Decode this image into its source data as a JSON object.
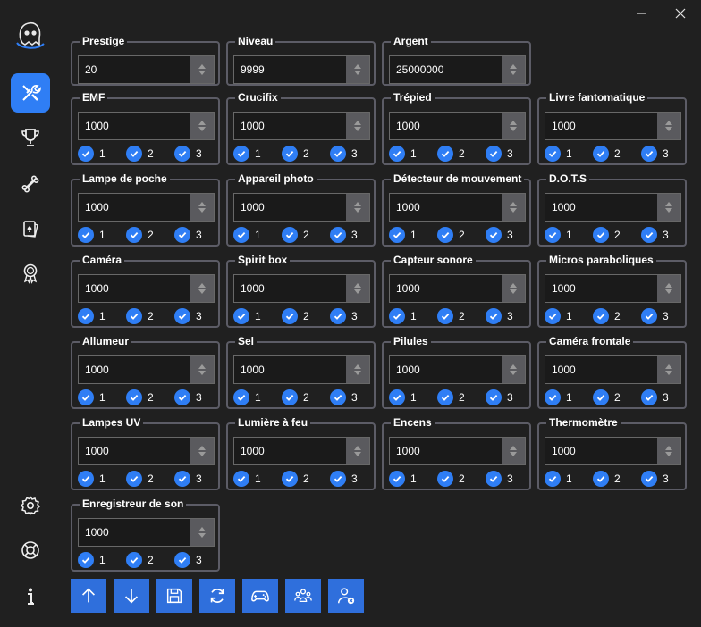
{
  "window": {
    "minimize_icon": "minimize-icon",
    "close_icon": "close-icon"
  },
  "sidebar": {
    "logo": "ghost-logo",
    "top_items": [
      {
        "icon": "tools-icon",
        "active": true
      },
      {
        "icon": "trophy-icon",
        "active": false
      },
      {
        "icon": "bone-icon",
        "active": false
      },
      {
        "icon": "cards-icon",
        "active": false
      },
      {
        "icon": "award-badge-icon",
        "active": false
      }
    ],
    "bottom_items": [
      {
        "icon": "gear-icon"
      },
      {
        "icon": "lifebuoy-icon"
      },
      {
        "icon": "info-icon"
      }
    ]
  },
  "stats": {
    "prestige": {
      "label": "Prestige",
      "value": "20"
    },
    "niveau": {
      "label": "Niveau",
      "value": "9999"
    },
    "argent": {
      "label": "Argent",
      "value": "25000000"
    }
  },
  "items": [
    {
      "label": "EMF",
      "value": "1000",
      "tiers": [
        "1",
        "2",
        "3"
      ]
    },
    {
      "label": "Crucifix",
      "value": "1000",
      "tiers": [
        "1",
        "2",
        "3"
      ]
    },
    {
      "label": "Trépied",
      "value": "1000",
      "tiers": [
        "1",
        "2",
        "3"
      ]
    },
    {
      "label": "Livre fantomatique",
      "value": "1000",
      "tiers": [
        "1",
        "2",
        "3"
      ]
    },
    {
      "label": "Lampe de poche",
      "value": "1000",
      "tiers": [
        "1",
        "2",
        "3"
      ]
    },
    {
      "label": "Appareil photo",
      "value": "1000",
      "tiers": [
        "1",
        "2",
        "3"
      ]
    },
    {
      "label": "Détecteur de mouvement",
      "value": "1000",
      "tiers": [
        "1",
        "2",
        "3"
      ]
    },
    {
      "label": "D.O.T.S",
      "value": "1000",
      "tiers": [
        "1",
        "2",
        "3"
      ]
    },
    {
      "label": "Caméra",
      "value": "1000",
      "tiers": [
        "1",
        "2",
        "3"
      ]
    },
    {
      "label": "Spirit box",
      "value": "1000",
      "tiers": [
        "1",
        "2",
        "3"
      ]
    },
    {
      "label": "Capteur sonore",
      "value": "1000",
      "tiers": [
        "1",
        "2",
        "3"
      ]
    },
    {
      "label": "Micros paraboliques",
      "value": "1000",
      "tiers": [
        "1",
        "2",
        "3"
      ]
    },
    {
      "label": "Allumeur",
      "value": "1000",
      "tiers": [
        "1",
        "2",
        "3"
      ]
    },
    {
      "label": "Sel",
      "value": "1000",
      "tiers": [
        "1",
        "2",
        "3"
      ]
    },
    {
      "label": "Pilules",
      "value": "1000",
      "tiers": [
        "1",
        "2",
        "3"
      ]
    },
    {
      "label": "Caméra frontale",
      "value": "1000",
      "tiers": [
        "1",
        "2",
        "3"
      ]
    },
    {
      "label": "Lampes UV",
      "value": "1000",
      "tiers": [
        "1",
        "2",
        "3"
      ]
    },
    {
      "label": "Lumière à feu",
      "value": "1000",
      "tiers": [
        "1",
        "2",
        "3"
      ]
    },
    {
      "label": "Encens",
      "value": "1000",
      "tiers": [
        "1",
        "2",
        "3"
      ]
    },
    {
      "label": "Thermomètre",
      "value": "1000",
      "tiers": [
        "1",
        "2",
        "3"
      ]
    },
    {
      "label": "Enregistreur de son",
      "value": "1000",
      "tiers": [
        "1",
        "2",
        "3"
      ]
    }
  ],
  "toolbar": [
    {
      "icon": "arrow-up-icon"
    },
    {
      "icon": "arrow-down-icon"
    },
    {
      "icon": "save-icon"
    },
    {
      "icon": "refresh-icon"
    },
    {
      "icon": "gamepad-icon"
    },
    {
      "icon": "users-group-icon"
    },
    {
      "icon": "user-remove-icon"
    }
  ],
  "colors": {
    "accent": "#2f7ef5",
    "background": "#202020",
    "border": "#5c5c66"
  }
}
